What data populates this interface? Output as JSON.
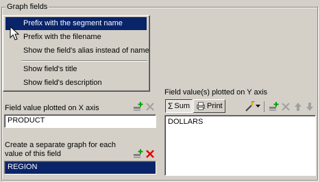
{
  "group": {
    "title": "Graph fields"
  },
  "menu": {
    "items": [
      {
        "label": "Prefix with the segment name"
      },
      {
        "label": "Prefix with the filename"
      },
      {
        "label": "Show the field's alias instead of name"
      },
      {
        "label": "Show field's title"
      },
      {
        "label": "Show field's description"
      }
    ]
  },
  "x_axis": {
    "label": "Field value plotted on X axis",
    "value": "PRODUCT"
  },
  "separate_graph": {
    "label_line1": "Create a separate graph for each",
    "label_line2": "value of this field",
    "value": "REGION"
  },
  "y_axis": {
    "label": "Field value(s) plotted on Y axis",
    "sum_button": "Sum",
    "print_button": "Print",
    "values": [
      "DOLLARS"
    ]
  },
  "colors": {
    "selection": "#0a246a",
    "face": "#d4d0c8",
    "delete_red": "#e00000"
  }
}
